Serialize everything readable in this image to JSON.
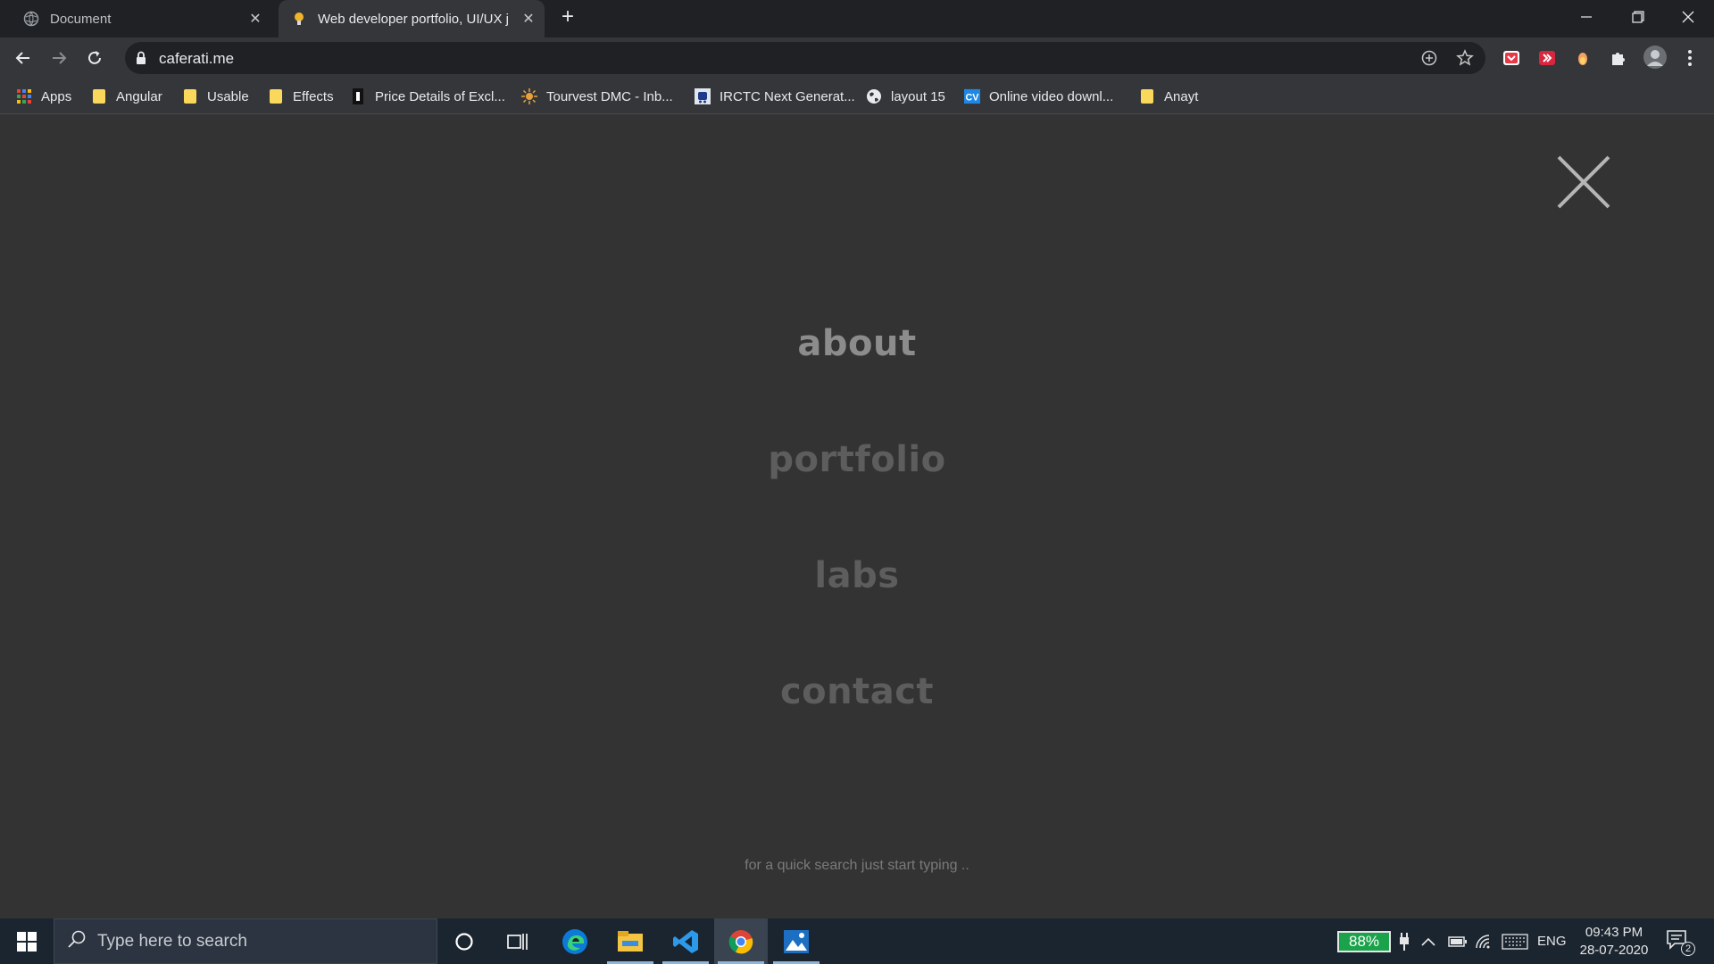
{
  "browser": {
    "tabs": [
      {
        "title": "Document",
        "active": false
      },
      {
        "title": "Web developer portfolio, UI/UX j",
        "active": true
      }
    ],
    "url": "caferati.me",
    "bookmarks": [
      {
        "label": "Apps",
        "icon": "apps-grid-icon"
      },
      {
        "label": "Angular",
        "icon": "folder-icon"
      },
      {
        "label": "Usable",
        "icon": "folder-icon"
      },
      {
        "label": "Effects",
        "icon": "folder-icon"
      },
      {
        "label": "Price Details of Excl...",
        "icon": "page-icon"
      },
      {
        "label": "Tourvest DMC - Inb...",
        "icon": "sun-icon"
      },
      {
        "label": "IRCTC Next Generat...",
        "icon": "train-icon"
      },
      {
        "label": "layout 15",
        "icon": "globe-icon"
      },
      {
        "label": "Online video downl...",
        "icon": "cv-icon"
      },
      {
        "label": "Anayt",
        "icon": "folder-icon"
      }
    ]
  },
  "page": {
    "menu": [
      {
        "label": "about"
      },
      {
        "label": "portfolio"
      },
      {
        "label": "labs"
      },
      {
        "label": "contact"
      }
    ],
    "hint": "for a quick search just start typing .."
  },
  "taskbar": {
    "search_placeholder": "Type here to search",
    "battery": "88%",
    "language": "ENG",
    "time": "09:43 PM",
    "date": "28-07-2020",
    "notification_count": "2"
  },
  "colors": {
    "page_bg": "#333333",
    "menu_active": "#8c8c8c",
    "menu_inactive": "#5d5d5d",
    "battery_fill": "#1aa34a"
  }
}
